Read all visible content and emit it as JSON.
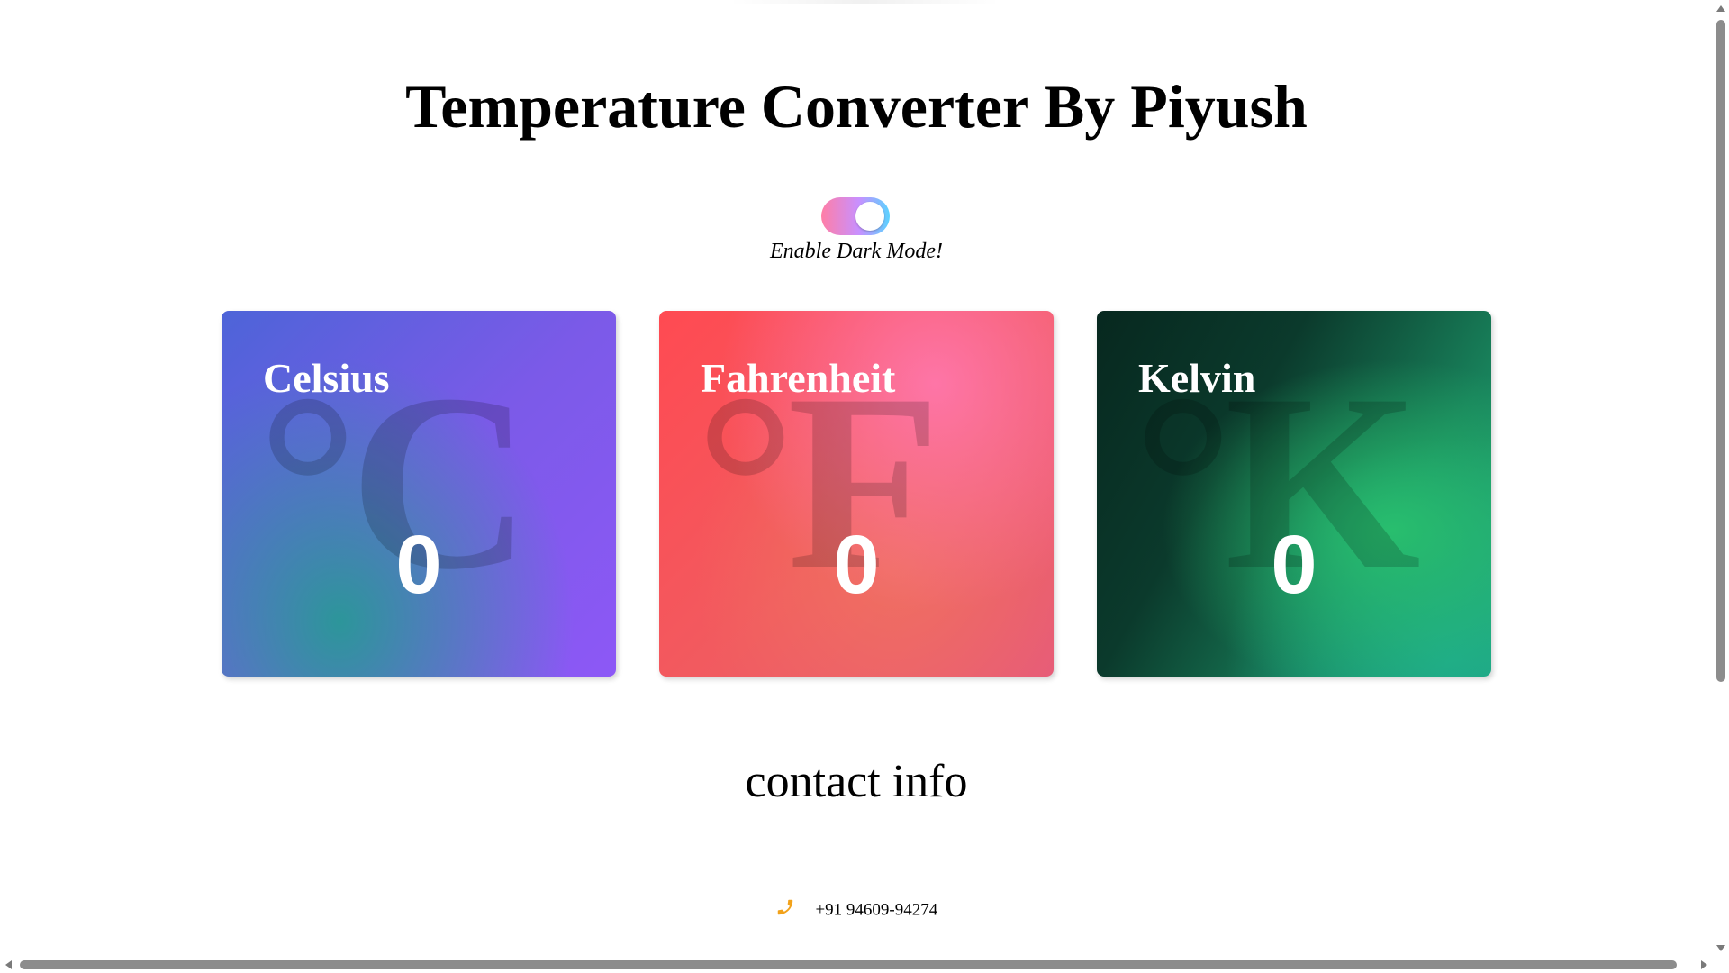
{
  "page": {
    "title": "Temperature Converter By Piyush"
  },
  "dark_mode_toggle": {
    "label": "Enable Dark Mode!",
    "state": "off"
  },
  "cards": [
    {
      "name": "Celsius",
      "symbol": "°C",
      "value": "0"
    },
    {
      "name": "Fahrenheit",
      "symbol": "°F",
      "value": "0"
    },
    {
      "name": "Kelvin",
      "symbol": "°K",
      "value": "0"
    }
  ],
  "contact": {
    "heading": "contact info",
    "phone_icon": "phone-icon",
    "phone": "+91 94609-94274"
  },
  "colors": {
    "phone_icon": "#f2a21b",
    "text": "#000000",
    "card_text": "#ffffff"
  }
}
